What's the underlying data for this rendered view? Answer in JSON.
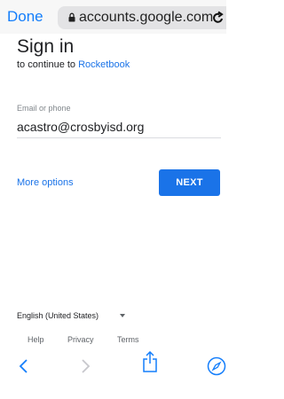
{
  "browser": {
    "done_label": "Done",
    "url": "accounts.google.com",
    "icons": [
      "lock-icon",
      "reload-icon"
    ]
  },
  "signin": {
    "title": "Sign in",
    "subtitle_prefix": "to continue to ",
    "app_name": "Rocketbook",
    "email_label": "Email or phone",
    "email_value": "acastro@crosbyisd.org",
    "more_options": "More options",
    "next_label": "NEXT"
  },
  "footer": {
    "language": "English (United States)",
    "links": [
      "Help",
      "Privacy",
      "Terms"
    ]
  },
  "toolbar": {
    "icons": [
      "back-icon",
      "forward-icon",
      "share-icon",
      "compass-icon"
    ]
  },
  "colors": {
    "ios_blue": "#147efb",
    "google_blue": "#1a73e8"
  }
}
